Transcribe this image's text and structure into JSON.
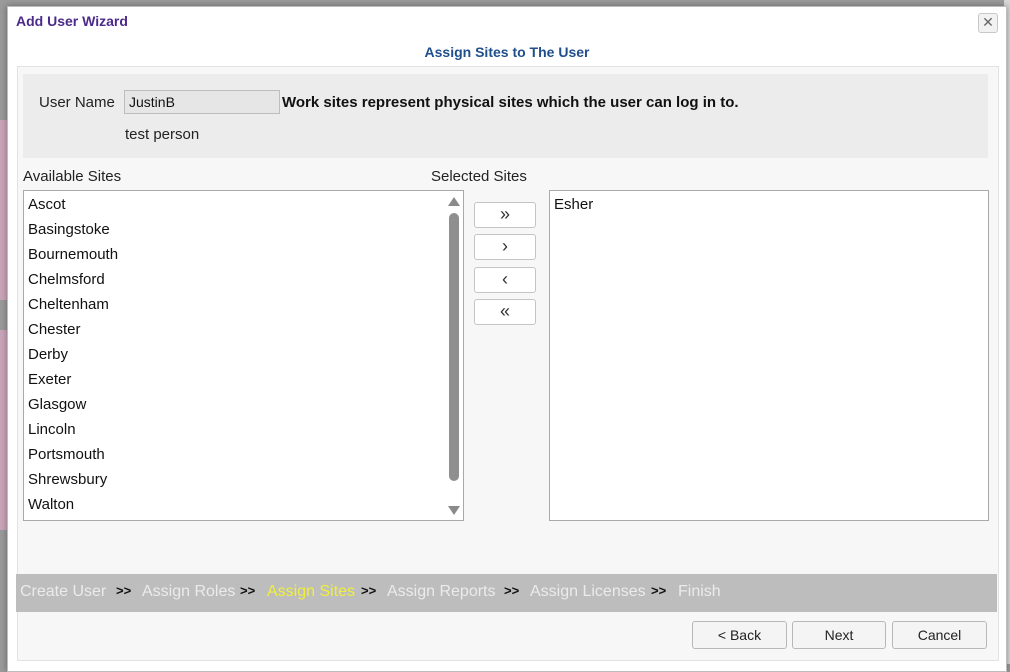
{
  "dialog": {
    "title": "Add User Wizard",
    "close_icon": "close-icon",
    "subtitle": "Assign Sites to The User"
  },
  "user": {
    "name_label": "User Name",
    "name_value": "JustinB",
    "description": "test person",
    "info_text": "Work sites represent physical sites which the user can log in to."
  },
  "available": {
    "label": "Available Sites",
    "items": [
      "Ascot",
      "Basingstoke",
      "Bournemouth",
      "Chelmsford",
      "Cheltenham",
      "Chester",
      "Derby",
      "Exeter",
      "Glasgow",
      "Lincoln",
      "Portsmouth",
      "Shrewsbury",
      "Walton"
    ]
  },
  "selected": {
    "label": "Selected Sites",
    "items": [
      "Esher"
    ]
  },
  "move_buttons": {
    "add_all": "»",
    "add_one": "›",
    "remove_one": "‹",
    "remove_all": "«"
  },
  "steps": {
    "items": [
      "Create User",
      "Assign Roles",
      "Assign Sites",
      "Assign Reports",
      "Assign Licenses",
      "Finish"
    ],
    "separator": ">>",
    "active_index": 2,
    "active_color": "#f1ef3a",
    "inactive_color": "#ebebeb"
  },
  "footer": {
    "back": "< Back",
    "next": "Next",
    "cancel": "Cancel"
  },
  "colors": {
    "title": "#4b2a8c",
    "subtitle": "#1f4e8c",
    "nav_background": "#bdbdbd"
  }
}
